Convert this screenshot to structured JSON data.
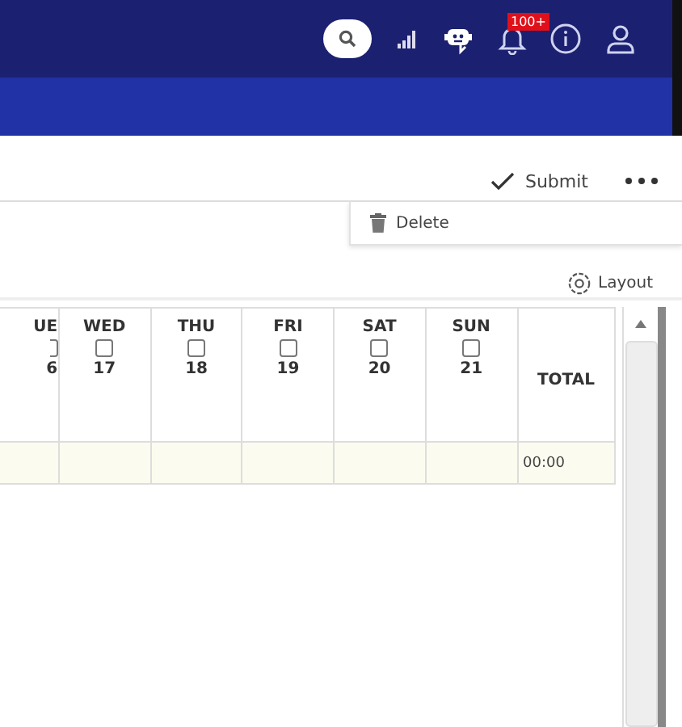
{
  "top_bar": {
    "notification_badge": "100+"
  },
  "toolbar": {
    "submit": "Submit"
  },
  "menu": {
    "items": [
      "Delete"
    ]
  },
  "layout_button": "Layout",
  "table": {
    "days": [
      {
        "day": "UE",
        "date": "6",
        "checked": false
      },
      {
        "day": "WED",
        "date": "17",
        "checked": false
      },
      {
        "day": "THU",
        "date": "18",
        "checked": false
      },
      {
        "day": "FRI",
        "date": "19",
        "checked": false
      },
      {
        "day": "SAT",
        "date": "20",
        "checked": false
      },
      {
        "day": "SUN",
        "date": "21",
        "checked": false
      }
    ],
    "total_header": "TOTAL",
    "total": "00:00"
  }
}
